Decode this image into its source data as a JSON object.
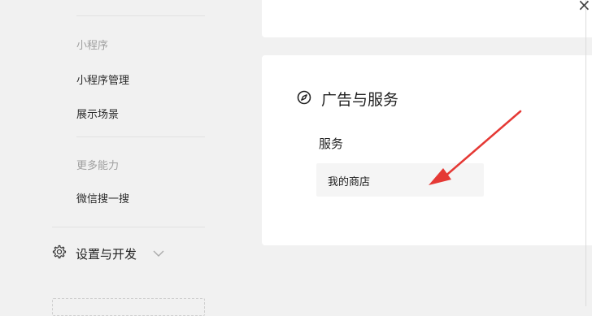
{
  "sidebar": {
    "section_miniprogram": "小程序",
    "item_manage": "小程序管理",
    "item_scene": "展示场景",
    "section_more": "更多能力",
    "item_search": "微信搜一搜",
    "settings_label": "设置与开发"
  },
  "main": {
    "section_title": "广告与服务",
    "sub_title": "服务",
    "store_label": "我的商店"
  },
  "icons": {
    "compass": "compass-icon",
    "gear": "gear-icon",
    "chevron": "chevron-down-icon",
    "close": "close-icon"
  },
  "colors": {
    "arrow": "#e53935",
    "background": "#f1f1f1",
    "card": "#ffffff"
  },
  "window": {
    "close_glyph": "×"
  }
}
